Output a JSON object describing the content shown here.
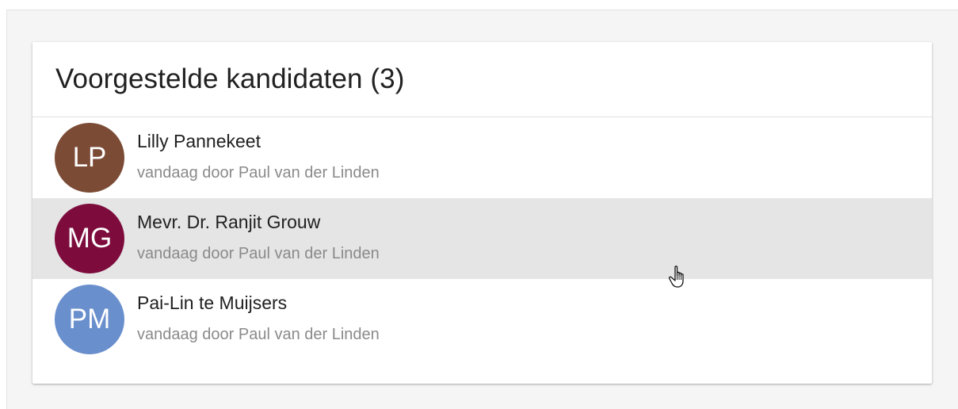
{
  "card": {
    "title": "Voorgestelde kandidaten (3)"
  },
  "candidates": [
    {
      "initials": "LP",
      "name": "Lilly Pannekeet",
      "meta": "vandaag door Paul van der Linden",
      "avatar_color": "#7b4b35",
      "hovered": false
    },
    {
      "initials": "MG",
      "name": "Mevr. Dr. Ranjit Grouw",
      "meta": "vandaag door Paul van der Linden",
      "avatar_color": "#7d0c3d",
      "hovered": true
    },
    {
      "initials": "PM",
      "name": "Pai-Lin te Muijsers",
      "meta": "vandaag door Paul van der Linden",
      "avatar_color": "#6a8fcd",
      "hovered": false
    }
  ],
  "colors": {
    "page_background": "#f5f5f5",
    "card_background": "#ffffff",
    "hover_background": "#e5e5e5",
    "name_text": "#212121",
    "meta_text": "#8a8a8a"
  },
  "cursor": {
    "icon": "hand-pointer-icon"
  }
}
